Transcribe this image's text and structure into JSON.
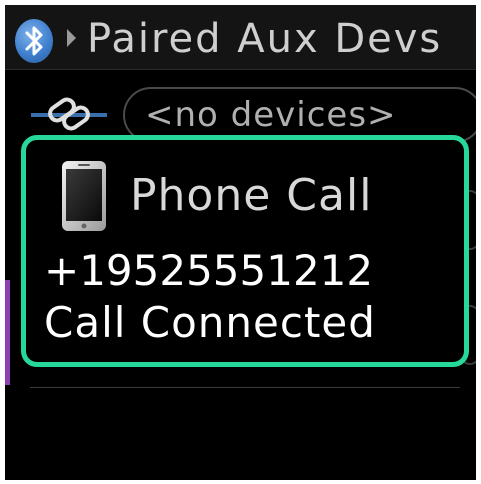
{
  "header": {
    "title": "Paired Aux Devs",
    "icon": "bluetooth-icon"
  },
  "devices": {
    "link_icon": "link-icon",
    "empty_label": "<no devices>"
  },
  "popup": {
    "icon": "phone-icon",
    "title": "Phone Call",
    "number": "+19525551212",
    "status": "Call Connected"
  },
  "colors": {
    "popup_border": "#27d89b",
    "accent": "#8a3fb3",
    "bluetooth": "#3f7fce",
    "background": "#000000"
  }
}
